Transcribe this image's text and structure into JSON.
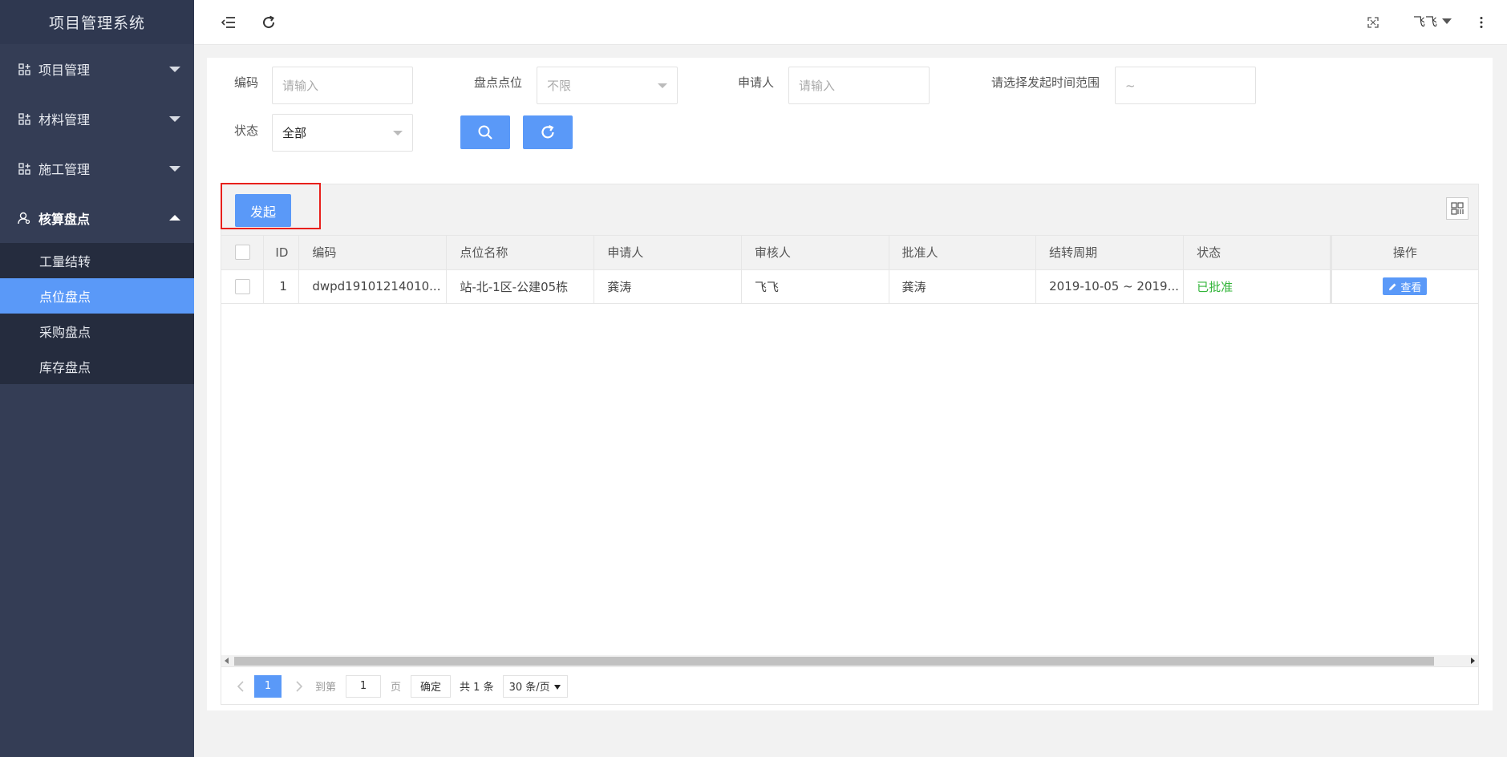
{
  "sidebar": {
    "brand": "项目管理系统",
    "menus": [
      {
        "label": "项目管理"
      },
      {
        "label": "材料管理"
      },
      {
        "label": "施工管理"
      },
      {
        "label": "核算盘点"
      }
    ],
    "submenu": [
      {
        "label": "工量结转"
      },
      {
        "label": "点位盘点"
      },
      {
        "label": "采购盘点"
      },
      {
        "label": "库存盘点"
      }
    ]
  },
  "header": {
    "user": "飞飞"
  },
  "filters": {
    "code_label": "编码",
    "code_placeholder": "请输入",
    "location_label": "盘点点位",
    "location_value": "不限",
    "applicant_label": "申请人",
    "applicant_placeholder": "请输入",
    "time_label": "请选择发起时间范围",
    "time_value": "~",
    "status_label": "状态",
    "status_value": "全部"
  },
  "toolbar": {
    "initiate_label": "发起"
  },
  "table": {
    "columns": [
      "ID",
      "编码",
      "点位名称",
      "申请人",
      "审核人",
      "批准人",
      "结转周期",
      "状态",
      "操作"
    ],
    "rows": [
      {
        "id": "1",
        "code": "dwpd19101214010...",
        "location": "站-北-1区-公建05栋",
        "applicant": "龚涛",
        "reviewer": "飞飞",
        "approver": "龚涛",
        "period": "2019-10-05 ~ 2019...",
        "status": "已批准",
        "action": "查看"
      }
    ]
  },
  "pager": {
    "current_page": "1",
    "goto_label": "到第",
    "goto_value": "1",
    "page_unit": "页",
    "confirm_label": "确定",
    "total_label": "共 1 条",
    "page_size": "30 条/页"
  },
  "colors": {
    "sidebar_bg": "#343d55",
    "primary": "#5a99f8",
    "status_approved": "#33b53a",
    "highlight": "#e8201c"
  }
}
